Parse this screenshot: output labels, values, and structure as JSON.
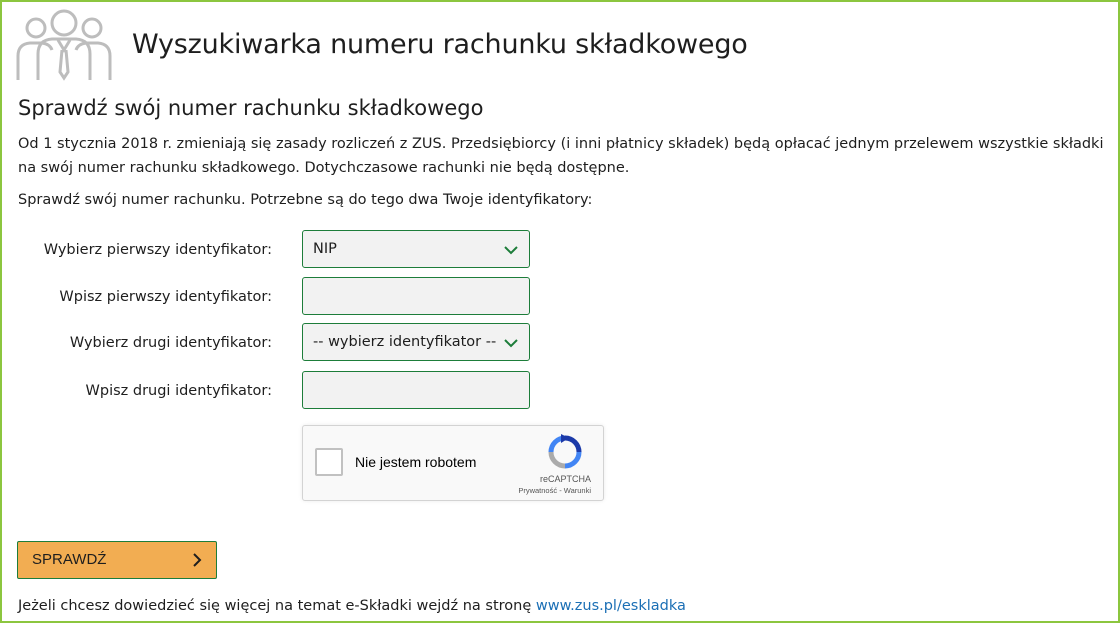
{
  "header": {
    "title": "Wyszukiwarka numeru rachunku składkowego",
    "logo_icon": "people-group-icon"
  },
  "subtitle": "Sprawdź swój numer rachunku składkowego",
  "intro": "Od 1 stycznia 2018 r. zmieniają się zasady rozliczeń z ZUS. Przedsiębiorcy (i inni płatnicy składek) będą opłacać jednym przelewem wszystkie składki na swój numer rachunku składkowego. Dotychczasowe rachunki nie będą dostępne.",
  "hint": "Sprawdź swój numer rachunku. Potrzebne są do tego dwa Twoje identyfikatory:",
  "form": {
    "first_select_label": "Wybierz pierwszy identyfikator:",
    "first_select_value": "NIP",
    "first_input_label": "Wpisz pierwszy identyfikator:",
    "first_input_value": "",
    "second_select_label": "Wybierz drugi identyfikator:",
    "second_select_value": "-- wybierz identyfikator --",
    "second_input_label": "Wpisz drugi identyfikator:",
    "second_input_value": ""
  },
  "captcha": {
    "label": "Nie jestem robotem",
    "brand": "reCAPTCHA",
    "terms": "Prywatność - Warunki"
  },
  "submit_label": "SPRAWDŹ",
  "footer": {
    "text": "Jeżeli chcesz dowiedzieć się więcej na temat e-Składki wejdź na stronę ",
    "link": "www.zus.pl/eskladka"
  },
  "colors": {
    "frame_border": "#8cc63f",
    "field_border": "#1d7d3a",
    "button_bg": "#f2ad52",
    "link": "#1b6fb5"
  }
}
